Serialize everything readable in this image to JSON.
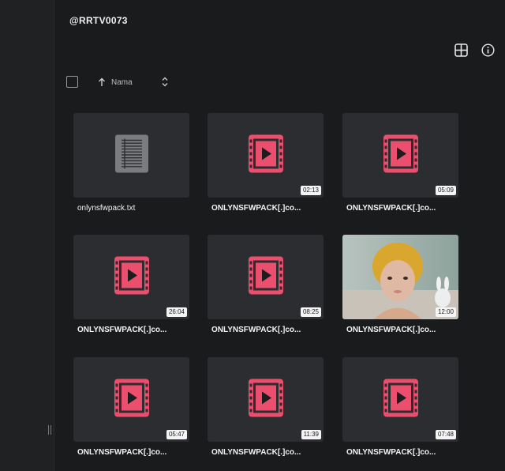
{
  "title": "@RRTV0073",
  "toolbar": {
    "grid_icon": "grid-view-icon",
    "info_icon": "info-icon"
  },
  "sort": {
    "label": "Nama",
    "arrow_icon": "arrow-up-icon",
    "toggle_icon": "chevron-updown-icon"
  },
  "colors": {
    "video_icon": "#ec4e6e",
    "background": "#1a1b1d",
    "tile": "#2c2d30"
  },
  "files": [
    {
      "name": "onlynsfwpack.txt",
      "type": "text",
      "duration": ""
    },
    {
      "name": "ONLYNSFWPACK[.]co...",
      "type": "video",
      "duration": "02:13"
    },
    {
      "name": "ONLYNSFWPACK[.]co...",
      "type": "video",
      "duration": "05:09"
    },
    {
      "name": "ONLYNSFWPACK[.]co...",
      "type": "video",
      "duration": "26:04"
    },
    {
      "name": "ONLYNSFWPACK[.]co...",
      "type": "video",
      "duration": "08:25"
    },
    {
      "name": "ONLYNSFWPACK[.]co...",
      "type": "video-thumb",
      "duration": "12:00"
    },
    {
      "name": "ONLYNSFWPACK[.]co...",
      "type": "video",
      "duration": "05:47"
    },
    {
      "name": "ONLYNSFWPACK[.]co...",
      "type": "video",
      "duration": "11:39"
    },
    {
      "name": "ONLYNSFWPACK[.]co...",
      "type": "video",
      "duration": "07:48"
    }
  ]
}
